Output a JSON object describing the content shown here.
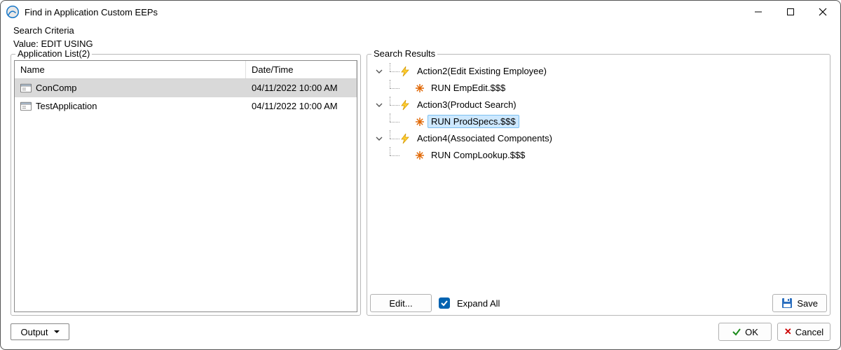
{
  "window": {
    "title": "Find in Application Custom EEPs"
  },
  "criteria": {
    "heading": "Search Criteria",
    "value_label": "Value: EDIT USING"
  },
  "app_list": {
    "legend": "Application List(2)",
    "columns": {
      "name": "Name",
      "date": "Date/Time"
    },
    "rows": [
      {
        "name": "ConComp",
        "date": "04/11/2022 10:00 AM",
        "selected": true
      },
      {
        "name": "TestApplication",
        "date": "04/11/2022 10:00 AM",
        "selected": false
      }
    ]
  },
  "results": {
    "legend": "Search Results",
    "nodes": [
      {
        "label": "Action2(Edit Existing Employee)",
        "child": "RUN EmpEdit.$$$",
        "selected": false
      },
      {
        "label": "Action3(Product Search)",
        "child": "RUN ProdSpecs.$$$",
        "selected": true
      },
      {
        "label": "Action4(Associated Components)",
        "child": "RUN CompLookup.$$$",
        "selected": false
      }
    ],
    "edit_btn": "Edit...",
    "expand_all": "Expand All",
    "save_btn": "Save"
  },
  "footer": {
    "output": "Output",
    "ok": "OK",
    "cancel": "Cancel"
  }
}
